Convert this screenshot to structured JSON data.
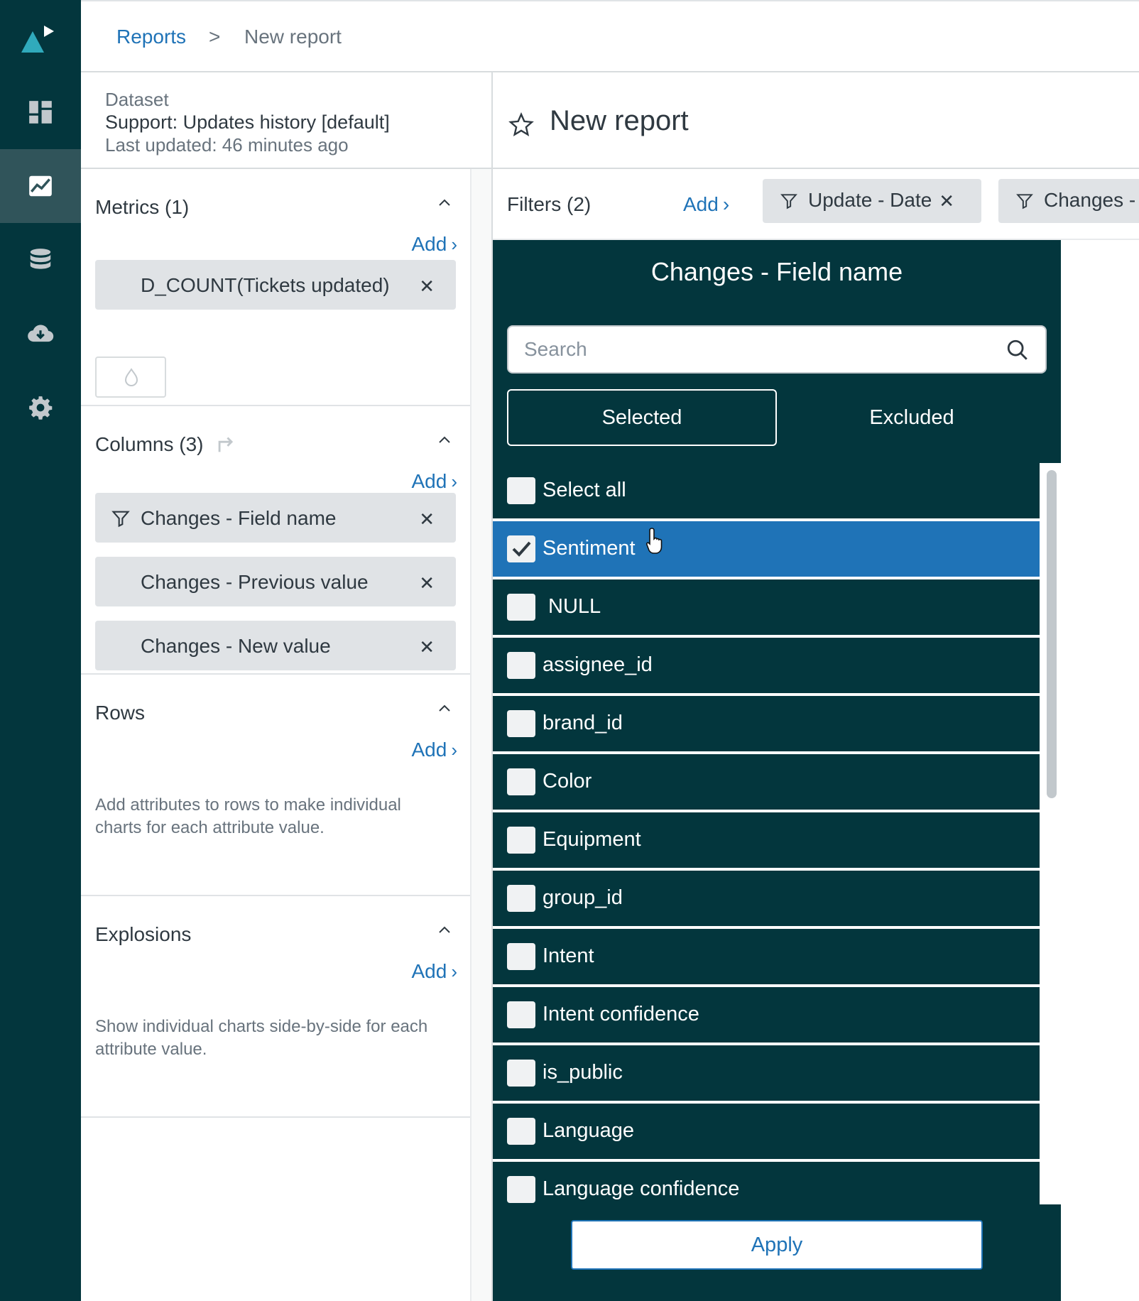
{
  "nav": {
    "items": [
      {
        "id": "dashboards",
        "icon": "dashboard-icon",
        "active": false
      },
      {
        "id": "reports",
        "icon": "chart-icon",
        "active": true
      },
      {
        "id": "datasets",
        "icon": "database-icon",
        "active": false
      },
      {
        "id": "downloads",
        "icon": "cloud-download-icon",
        "active": false
      },
      {
        "id": "settings",
        "icon": "gear-icon",
        "active": false
      }
    ]
  },
  "breadcrumb": {
    "parent": "Reports",
    "separator": ">",
    "current": "New report"
  },
  "dataset": {
    "label": "Dataset",
    "name": "Support: Updates history [default]",
    "updated": "Last updated: 46 minutes ago"
  },
  "metrics": {
    "title": "Metrics (1)",
    "add": "Add",
    "items": [
      "D_COUNT(Tickets updated)"
    ]
  },
  "columns": {
    "title": "Columns (3)",
    "add": "Add",
    "items": [
      "Changes - Field name",
      "Changes - Previous value",
      "Changes - New value"
    ]
  },
  "rows": {
    "title": "Rows",
    "add": "Add",
    "help": "Add attributes to rows to make individual charts for each attribute value."
  },
  "explosions": {
    "title": "Explosions",
    "add": "Add",
    "help": "Show individual charts side-by-side for each attribute value."
  },
  "report": {
    "title": "New report",
    "filters_label": "Filters (2)",
    "filters_add": "Add",
    "filter_chips": [
      "Update - Date",
      "Changes - Field name"
    ]
  },
  "popover": {
    "title": "Changes - Field name",
    "search_placeholder": "Search",
    "tab_selected": "Selected",
    "tab_excluded": "Excluded",
    "options": [
      {
        "label": "Select all",
        "checked": false
      },
      {
        "label": "Sentiment",
        "checked": true
      },
      {
        "label": " NULL",
        "checked": false
      },
      {
        "label": "assignee_id",
        "checked": false
      },
      {
        "label": "brand_id",
        "checked": false
      },
      {
        "label": "Color",
        "checked": false
      },
      {
        "label": "Equipment",
        "checked": false
      },
      {
        "label": "group_id",
        "checked": false
      },
      {
        "label": "Intent",
        "checked": false
      },
      {
        "label": "Intent confidence",
        "checked": false
      },
      {
        "label": "is_public",
        "checked": false
      },
      {
        "label": "Language",
        "checked": false
      },
      {
        "label": "Language confidence",
        "checked": false
      }
    ],
    "apply": "Apply"
  },
  "colors": {
    "rail": "#03363d",
    "rail_active": "#30545a",
    "link": "#1f73b7",
    "selected_row": "#1f73b7",
    "chip": "#e0e3e6"
  }
}
